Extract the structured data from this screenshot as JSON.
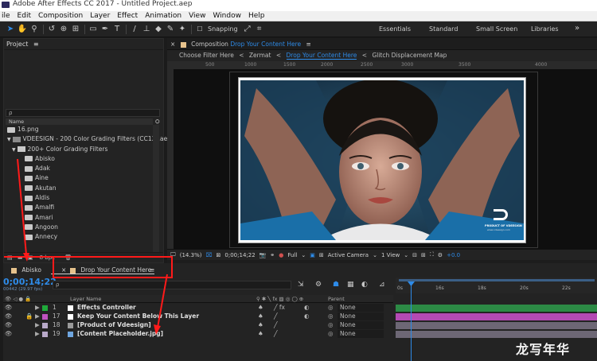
{
  "window": {
    "title": "Adobe After Effects CC 2017 - Untitled Project.aep"
  },
  "menu": [
    "ile",
    "Edit",
    "Composition",
    "Layer",
    "Effect",
    "Animation",
    "View",
    "Window",
    "Help"
  ],
  "toolbar": {
    "snapping_label": "Snapping",
    "workspaces": [
      "Essentials",
      "Standard",
      "Small Screen",
      "Libraries"
    ],
    "overflow": "»"
  },
  "project": {
    "title": "Project",
    "menu_icon": "≡",
    "search_placeholder": "ρ",
    "name_header": "Name",
    "items": [
      {
        "label": "16.png",
        "type": "file",
        "indent": 0
      },
      {
        "label": "VDEESIGN - 200 Color Grading Filters (CC12).aep",
        "type": "project",
        "indent": 0
      },
      {
        "label": "200+ Color Grading Filters",
        "type": "folder",
        "indent": 1
      },
      {
        "label": "Abisko",
        "type": "comp",
        "indent": 2
      },
      {
        "label": "Adak",
        "type": "comp",
        "indent": 2
      },
      {
        "label": "Aine",
        "type": "comp",
        "indent": 2
      },
      {
        "label": "Akutan",
        "type": "comp",
        "indent": 2
      },
      {
        "label": "Aldis",
        "type": "comp",
        "indent": 2
      },
      {
        "label": "Amalfi",
        "type": "comp",
        "indent": 2
      },
      {
        "label": "Amari",
        "type": "comp",
        "indent": 2
      },
      {
        "label": "Angoon",
        "type": "comp",
        "indent": 2
      },
      {
        "label": "Annecy",
        "type": "comp",
        "indent": 2
      }
    ],
    "footer_bpc": "8 bpc"
  },
  "composition": {
    "panel_label": "Composition",
    "comp_name": "Drop Your Content Here",
    "menu_icon": "≡",
    "breadcrumb": [
      "Choose Filter Here",
      "Zermat",
      "Drop Your Content Here",
      "Glitch Displacement Map"
    ],
    "ruler_ticks": [
      "500",
      "1000",
      "1500",
      "2000",
      "2500",
      "3000",
      "3500",
      "4000"
    ],
    "logo_text": "PRODUCT OF VDEESIGN",
    "logo_url": "www.vdeesign.com"
  },
  "viewer_controls": {
    "zoom": "(14.3%)",
    "timecode": "0;00;14;22",
    "resolution": "Full",
    "camera": "Active Camera",
    "views": "1 View",
    "exposure": "+0.0"
  },
  "timeline": {
    "tabs": [
      {
        "label": "Abisko"
      },
      {
        "label": "Drop Your Content Here"
      }
    ],
    "timecode": "0;00;14;22",
    "fps": "00442 (29.97 fps)",
    "search_placeholder": "ρ",
    "col_layer_name": "Layer Name",
    "col_parent": "Parent",
    "time_labels": [
      "0s",
      "16s",
      "18s",
      "20s",
      "22s"
    ],
    "layers": [
      {
        "num": "1",
        "name": "Effects Controller",
        "color": "#1faa3a",
        "parent": "None",
        "track": "#2c8a45"
      },
      {
        "num": "17",
        "name": "Keep Your Content Below This Layer",
        "color": "#c052c0",
        "parent": "None",
        "track": "#b34ab3"
      },
      {
        "num": "18",
        "name": "[Product of Vdeesign]",
        "color": "#b8a9c9",
        "parent": "None",
        "track": "#6d6775"
      },
      {
        "num": "19",
        "name": "[Content Placeholder.jpg]",
        "color": "#b8a9c9",
        "parent": "None",
        "track": "#6d6775"
      }
    ]
  },
  "watermark": "龙写年华",
  "colors": {
    "accent": "#2e8be8",
    "annotation": "#ff1a1a",
    "label_green": "#1faa3a",
    "label_magenta": "#c052c0"
  }
}
